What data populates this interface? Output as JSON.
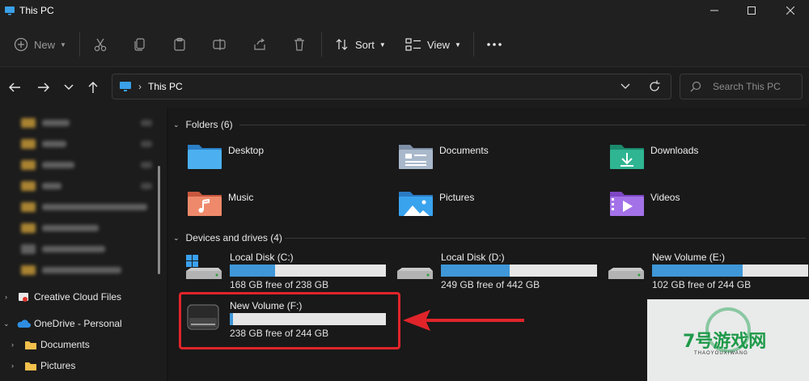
{
  "window": {
    "title": "This PC"
  },
  "toolbar": {
    "new_label": "New",
    "sort_label": "Sort",
    "view_label": "View"
  },
  "address": {
    "path": "This PC",
    "search_placeholder": "Search This PC"
  },
  "sidebar": {
    "items": [
      {
        "label": "Creative Cloud Files"
      },
      {
        "label": "OneDrive - Personal"
      },
      {
        "label": "Documents"
      },
      {
        "label": "Pictures"
      }
    ]
  },
  "groups": {
    "folders_header": "Folders (6)",
    "devices_header": "Devices and drives (4)"
  },
  "folders": [
    {
      "label": "Desktop",
      "icon": "desktop-folder-icon"
    },
    {
      "label": "Documents",
      "icon": "documents-folder-icon"
    },
    {
      "label": "Downloads",
      "icon": "downloads-folder-icon"
    },
    {
      "label": "Music",
      "icon": "music-folder-icon"
    },
    {
      "label": "Pictures",
      "icon": "pictures-folder-icon"
    },
    {
      "label": "Videos",
      "icon": "videos-folder-icon"
    }
  ],
  "drives": [
    {
      "label": "Local Disk (C:)",
      "free": "168 GB free of 238 GB",
      "used_fraction": 0.29
    },
    {
      "label": "Local Disk (D:)",
      "free": "249 GB free of 442 GB",
      "used_fraction": 0.44
    },
    {
      "label": "New Volume (E:)",
      "free": "102 GB free of 244 GB",
      "used_fraction": 0.58
    },
    {
      "label": "New Volume (F:)",
      "free": "238 GB free of 244 GB",
      "used_fraction": 0.02
    }
  ],
  "colors": {
    "accent": "#3f97d8",
    "annotation": "#e0242a"
  },
  "watermark": {
    "text": "7号游戏网",
    "sub": "THAOYOUXIWANG"
  }
}
